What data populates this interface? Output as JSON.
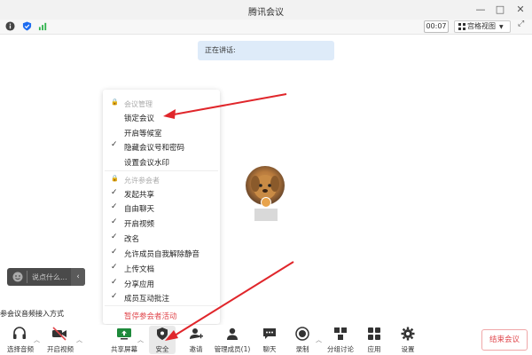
{
  "window": {
    "title": "腾讯会议",
    "minimize": "—",
    "maximize": "□",
    "close": "✕"
  },
  "status": {
    "timer": "00:07",
    "view_label": "宫格视图"
  },
  "speaking": {
    "label": "正在讲话:"
  },
  "security_menu": {
    "section_manage": "会议管理",
    "lock_meeting": "锁定会议",
    "waiting_room": "开启等候室",
    "hide_id": "隐藏会议号和密码",
    "watermark": "设置会议水印",
    "section_allow": "允许参会者",
    "share": "发起共享",
    "chat": "自由聊天",
    "video": "开启视频",
    "rename": "改名",
    "unmute": "允许成员自我解除静音",
    "upload": "上传文档",
    "share_app": "分享应用",
    "interact": "成员互动批注",
    "pause": "暂停参会者活动"
  },
  "chat_input": {
    "placeholder": "说点什么..."
  },
  "audio_tip": "参会议音频接入方式",
  "toolbar": {
    "audio": "选择音频",
    "video": "开启视频",
    "share": "共享屏幕",
    "security": "安全",
    "invite": "邀请",
    "members": "管理成员(1)",
    "chat": "聊天",
    "record": "录制",
    "breakout": "分组讨论",
    "apps": "应用",
    "settings": "设置",
    "end": "结束会议"
  },
  "colors": {
    "accent": "#0a6cff",
    "danger": "#e0474c",
    "arrow": "#e0262b"
  }
}
